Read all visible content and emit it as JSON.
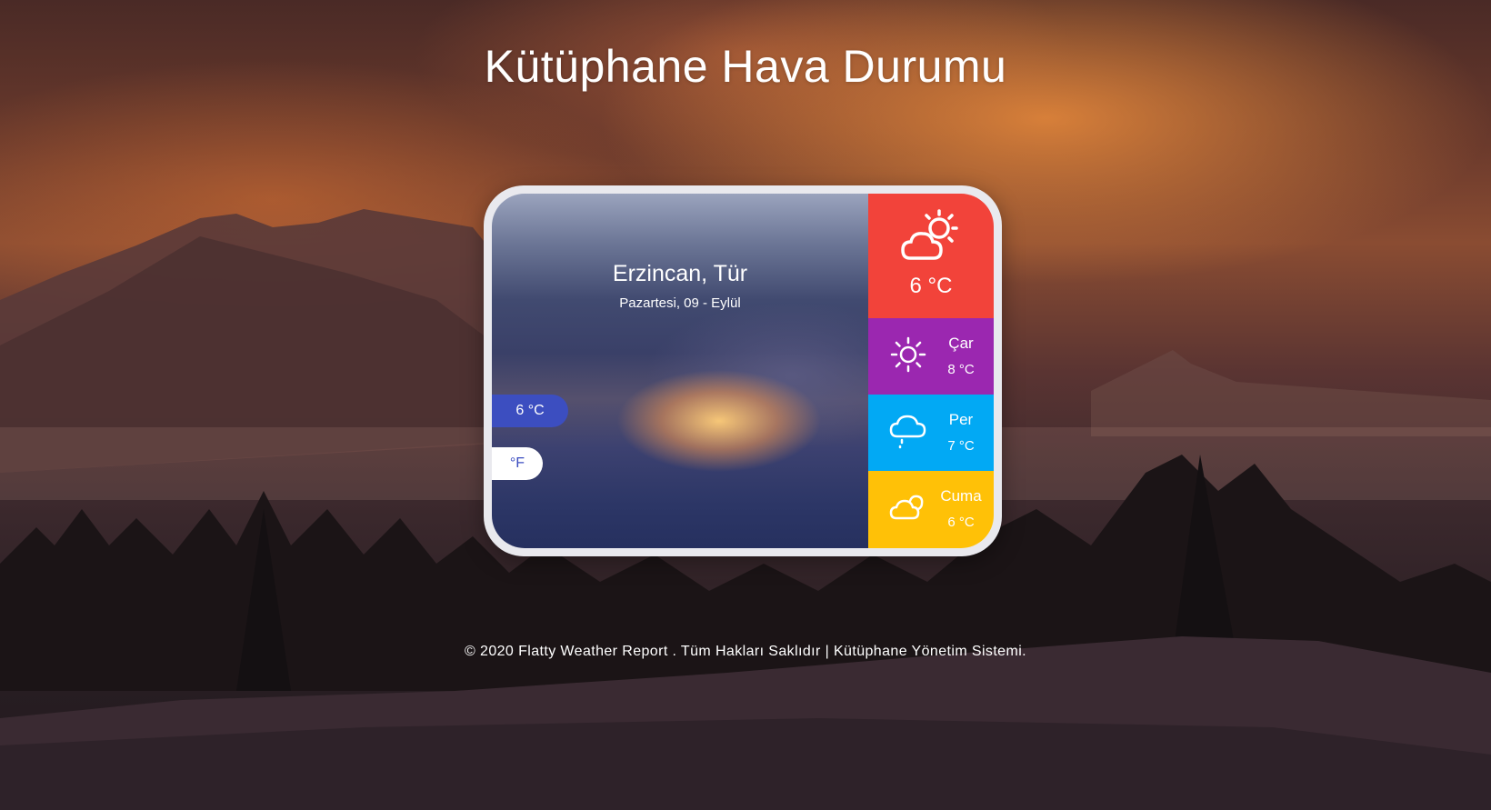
{
  "page": {
    "title": "Kütüphane Hava Durumu",
    "footer": "© 2020 Flatty Weather Report . Tüm Hakları Saklıdır | Kütüphane Yönetim Sistemi."
  },
  "current": {
    "location": "Erzincan, Tür",
    "date": "Pazartesi, 09 - Eylül",
    "temp": "6 °C",
    "icon": "partly-cloudy-icon",
    "color": "#f2433a"
  },
  "units": {
    "celsius_label": "6 °C",
    "fahrenheit_label": "°F"
  },
  "forecast": [
    {
      "day": "Çar",
      "temp": "8 °C",
      "icon": "sun-icon",
      "color": "#9b27b0"
    },
    {
      "day": "Per",
      "temp": "7 °C",
      "icon": "rain-cloud-icon",
      "color": "#02a9f4"
    },
    {
      "day": "Cuma",
      "temp": "6 °C",
      "icon": "cloud-icon",
      "color": "#ffc107"
    }
  ]
}
